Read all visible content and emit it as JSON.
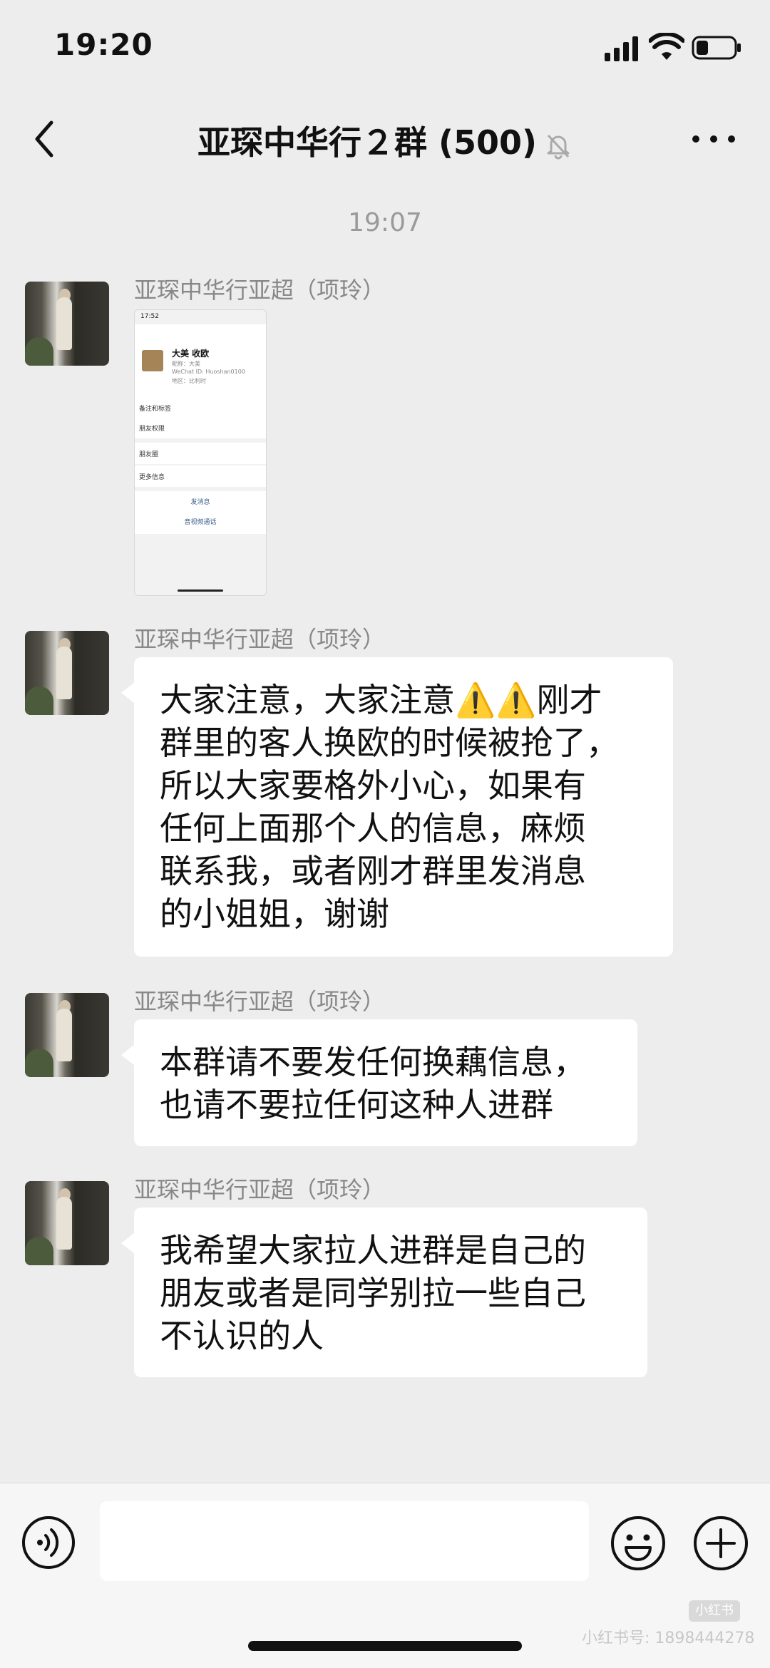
{
  "status": {
    "time": "19:20"
  },
  "header": {
    "title": "亚琛中华行２群 (500)"
  },
  "timestamp": "19:07",
  "messages": [
    {
      "sender": "亚琛中华行亚超（项玲）",
      "type": "image",
      "image": {
        "status_time": "17:52",
        "name": "大美 收欧",
        "nickname": "昵称：大美",
        "wechat_id": "WeChat ID: Huoshan0100",
        "region": "地区：比利时",
        "rows": [
          "备注和标签",
          "朋友权限",
          "朋友圈",
          "更多信息"
        ],
        "actions": [
          "发消息",
          "音视频通话"
        ]
      }
    },
    {
      "sender": "亚琛中华行亚超（项玲）",
      "type": "text",
      "lines": [
        "大家注意，大家注意⚠️⚠️刚才",
        "群里的客人换欧的时候被抢了，",
        "所以大家要格外小心，如果有",
        "任何上面那个人的信息，麻烦",
        "联系我，或者刚才群里发消息",
        "的小姐姐，谢谢"
      ]
    },
    {
      "sender": "亚琛中华行亚超（项玲）",
      "type": "text",
      "lines": [
        "本群请不要发任何换藕信息，",
        "也请不要拉任何这种人进群"
      ]
    },
    {
      "sender": "亚琛中华行亚超（项玲）",
      "type": "text",
      "lines": [
        "我希望大家拉人进群是自己的",
        "朋友或者是同学别拉一些自己",
        "不认识的人"
      ]
    }
  ],
  "watermark": {
    "logo": "小红书",
    "text": "小红书号: 1898444278"
  }
}
